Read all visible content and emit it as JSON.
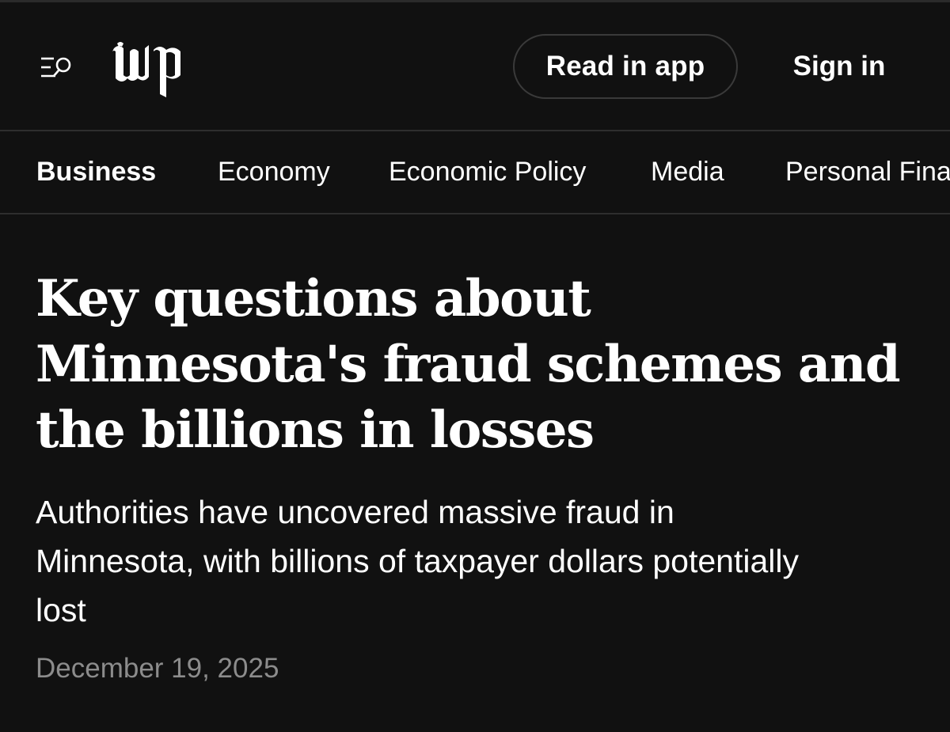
{
  "header": {
    "menu_icon": "menu-search-icon",
    "logo_icon": "wp-logo-icon",
    "read_in_app_label": "Read in app",
    "sign_in_label": "Sign in"
  },
  "section_nav": {
    "items": [
      {
        "label": "Business",
        "active": true
      },
      {
        "label": "Economy",
        "active": false
      },
      {
        "label": "Economic Policy",
        "active": false
      },
      {
        "label": "Media",
        "active": false
      },
      {
        "label": "Personal Finance",
        "active": false
      }
    ]
  },
  "article": {
    "headline": "Key questions about Minnesota's fraud schemes and the billions in losses",
    "dek": "Authorities have uncovered massive fraud in Minnesota, with billions of taxpayer dollars potentially lost",
    "date": "December 19, 2025"
  },
  "colors": {
    "background": "#111111",
    "text": "#ffffff",
    "muted_text": "#8c8c8c",
    "divider": "#2e2e2e"
  }
}
